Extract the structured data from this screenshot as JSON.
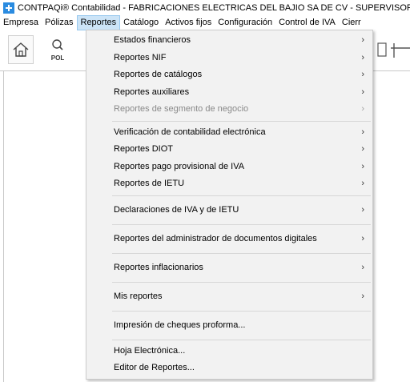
{
  "window": {
    "title": "CONTPAQi® Contabilidad - FABRICACIONES ELECTRICAS DEL BAJIO SA DE CV - SUPERVISOR"
  },
  "menubar": {
    "items": [
      "Empresa",
      "Pólizas",
      "Reportes",
      "Catálogo",
      "Activos fijos",
      "Configuración",
      "Control de IVA",
      "Cierr"
    ]
  },
  "toolbar": {
    "pol_label": "POL"
  },
  "reportes_menu": {
    "items": [
      {
        "label": "Estados financieros",
        "arrow": "›"
      },
      {
        "label": "Reportes NIF",
        "arrow": "›"
      },
      {
        "label": "Reportes de catálogos",
        "arrow": "›"
      },
      {
        "label": "Reportes auxiliares",
        "arrow": "›"
      },
      {
        "label": "Reportes de segmento de negocio",
        "arrow": "›"
      },
      {
        "label": "Verificación de contabilidad electrónica",
        "arrow": "›"
      },
      {
        "label": "Reportes DIOT",
        "arrow": "›"
      },
      {
        "label": "Reportes pago provisional de IVA",
        "arrow": "›"
      },
      {
        "label": "Reportes de IETU",
        "arrow": "›"
      },
      {
        "label": "Declaraciones de IVA y de IETU",
        "arrow": "›"
      },
      {
        "label": "Reportes del administrador de documentos digitales",
        "arrow": "›"
      },
      {
        "label": "Reportes inflacionarios",
        "arrow": "›"
      },
      {
        "label": "Mis reportes",
        "arrow": "›"
      },
      {
        "label": "Impresión de cheques proforma..."
      },
      {
        "label": "Hoja Electrónica..."
      },
      {
        "label": "Editor de Reportes..."
      }
    ]
  }
}
